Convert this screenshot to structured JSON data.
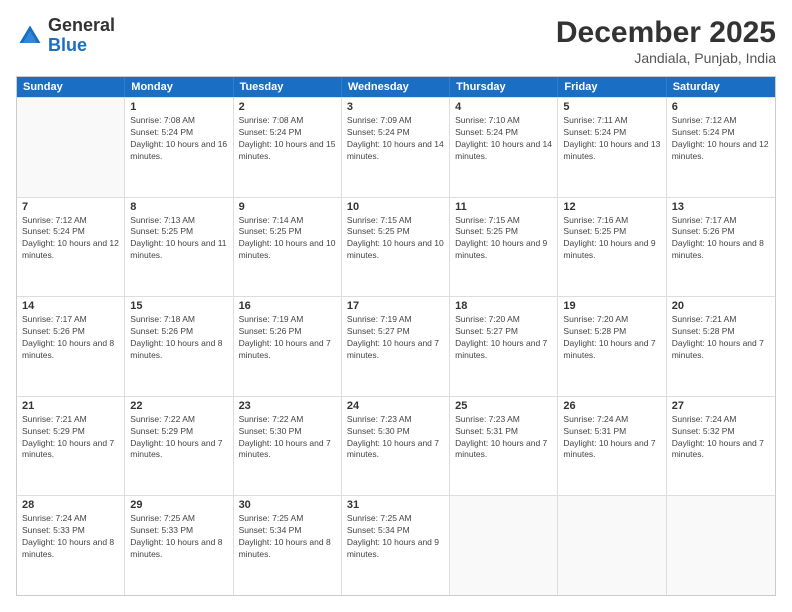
{
  "header": {
    "logo": {
      "general": "General",
      "blue": "Blue"
    },
    "title": "December 2025",
    "location": "Jandiala, Punjab, India"
  },
  "weekdays": [
    "Sunday",
    "Monday",
    "Tuesday",
    "Wednesday",
    "Thursday",
    "Friday",
    "Saturday"
  ],
  "weeks": [
    [
      {
        "day": "",
        "sunrise": "",
        "sunset": "",
        "daylight": ""
      },
      {
        "day": "1",
        "sunrise": "Sunrise: 7:08 AM",
        "sunset": "Sunset: 5:24 PM",
        "daylight": "Daylight: 10 hours and 16 minutes."
      },
      {
        "day": "2",
        "sunrise": "Sunrise: 7:08 AM",
        "sunset": "Sunset: 5:24 PM",
        "daylight": "Daylight: 10 hours and 15 minutes."
      },
      {
        "day": "3",
        "sunrise": "Sunrise: 7:09 AM",
        "sunset": "Sunset: 5:24 PM",
        "daylight": "Daylight: 10 hours and 14 minutes."
      },
      {
        "day": "4",
        "sunrise": "Sunrise: 7:10 AM",
        "sunset": "Sunset: 5:24 PM",
        "daylight": "Daylight: 10 hours and 14 minutes."
      },
      {
        "day": "5",
        "sunrise": "Sunrise: 7:11 AM",
        "sunset": "Sunset: 5:24 PM",
        "daylight": "Daylight: 10 hours and 13 minutes."
      },
      {
        "day": "6",
        "sunrise": "Sunrise: 7:12 AM",
        "sunset": "Sunset: 5:24 PM",
        "daylight": "Daylight: 10 hours and 12 minutes."
      }
    ],
    [
      {
        "day": "7",
        "sunrise": "Sunrise: 7:12 AM",
        "sunset": "Sunset: 5:24 PM",
        "daylight": "Daylight: 10 hours and 12 minutes."
      },
      {
        "day": "8",
        "sunrise": "Sunrise: 7:13 AM",
        "sunset": "Sunset: 5:25 PM",
        "daylight": "Daylight: 10 hours and 11 minutes."
      },
      {
        "day": "9",
        "sunrise": "Sunrise: 7:14 AM",
        "sunset": "Sunset: 5:25 PM",
        "daylight": "Daylight: 10 hours and 10 minutes."
      },
      {
        "day": "10",
        "sunrise": "Sunrise: 7:15 AM",
        "sunset": "Sunset: 5:25 PM",
        "daylight": "Daylight: 10 hours and 10 minutes."
      },
      {
        "day": "11",
        "sunrise": "Sunrise: 7:15 AM",
        "sunset": "Sunset: 5:25 PM",
        "daylight": "Daylight: 10 hours and 9 minutes."
      },
      {
        "day": "12",
        "sunrise": "Sunrise: 7:16 AM",
        "sunset": "Sunset: 5:25 PM",
        "daylight": "Daylight: 10 hours and 9 minutes."
      },
      {
        "day": "13",
        "sunrise": "Sunrise: 7:17 AM",
        "sunset": "Sunset: 5:26 PM",
        "daylight": "Daylight: 10 hours and 8 minutes."
      }
    ],
    [
      {
        "day": "14",
        "sunrise": "Sunrise: 7:17 AM",
        "sunset": "Sunset: 5:26 PM",
        "daylight": "Daylight: 10 hours and 8 minutes."
      },
      {
        "day": "15",
        "sunrise": "Sunrise: 7:18 AM",
        "sunset": "Sunset: 5:26 PM",
        "daylight": "Daylight: 10 hours and 8 minutes."
      },
      {
        "day": "16",
        "sunrise": "Sunrise: 7:19 AM",
        "sunset": "Sunset: 5:26 PM",
        "daylight": "Daylight: 10 hours and 7 minutes."
      },
      {
        "day": "17",
        "sunrise": "Sunrise: 7:19 AM",
        "sunset": "Sunset: 5:27 PM",
        "daylight": "Daylight: 10 hours and 7 minutes."
      },
      {
        "day": "18",
        "sunrise": "Sunrise: 7:20 AM",
        "sunset": "Sunset: 5:27 PM",
        "daylight": "Daylight: 10 hours and 7 minutes."
      },
      {
        "day": "19",
        "sunrise": "Sunrise: 7:20 AM",
        "sunset": "Sunset: 5:28 PM",
        "daylight": "Daylight: 10 hours and 7 minutes."
      },
      {
        "day": "20",
        "sunrise": "Sunrise: 7:21 AM",
        "sunset": "Sunset: 5:28 PM",
        "daylight": "Daylight: 10 hours and 7 minutes."
      }
    ],
    [
      {
        "day": "21",
        "sunrise": "Sunrise: 7:21 AM",
        "sunset": "Sunset: 5:29 PM",
        "daylight": "Daylight: 10 hours and 7 minutes."
      },
      {
        "day": "22",
        "sunrise": "Sunrise: 7:22 AM",
        "sunset": "Sunset: 5:29 PM",
        "daylight": "Daylight: 10 hours and 7 minutes."
      },
      {
        "day": "23",
        "sunrise": "Sunrise: 7:22 AM",
        "sunset": "Sunset: 5:30 PM",
        "daylight": "Daylight: 10 hours and 7 minutes."
      },
      {
        "day": "24",
        "sunrise": "Sunrise: 7:23 AM",
        "sunset": "Sunset: 5:30 PM",
        "daylight": "Daylight: 10 hours and 7 minutes."
      },
      {
        "day": "25",
        "sunrise": "Sunrise: 7:23 AM",
        "sunset": "Sunset: 5:31 PM",
        "daylight": "Daylight: 10 hours and 7 minutes."
      },
      {
        "day": "26",
        "sunrise": "Sunrise: 7:24 AM",
        "sunset": "Sunset: 5:31 PM",
        "daylight": "Daylight: 10 hours and 7 minutes."
      },
      {
        "day": "27",
        "sunrise": "Sunrise: 7:24 AM",
        "sunset": "Sunset: 5:32 PM",
        "daylight": "Daylight: 10 hours and 7 minutes."
      }
    ],
    [
      {
        "day": "28",
        "sunrise": "Sunrise: 7:24 AM",
        "sunset": "Sunset: 5:33 PM",
        "daylight": "Daylight: 10 hours and 8 minutes."
      },
      {
        "day": "29",
        "sunrise": "Sunrise: 7:25 AM",
        "sunset": "Sunset: 5:33 PM",
        "daylight": "Daylight: 10 hours and 8 minutes."
      },
      {
        "day": "30",
        "sunrise": "Sunrise: 7:25 AM",
        "sunset": "Sunset: 5:34 PM",
        "daylight": "Daylight: 10 hours and 8 minutes."
      },
      {
        "day": "31",
        "sunrise": "Sunrise: 7:25 AM",
        "sunset": "Sunset: 5:34 PM",
        "daylight": "Daylight: 10 hours and 9 minutes."
      },
      {
        "day": "",
        "sunrise": "",
        "sunset": "",
        "daylight": ""
      },
      {
        "day": "",
        "sunrise": "",
        "sunset": "",
        "daylight": ""
      },
      {
        "day": "",
        "sunrise": "",
        "sunset": "",
        "daylight": ""
      }
    ]
  ]
}
